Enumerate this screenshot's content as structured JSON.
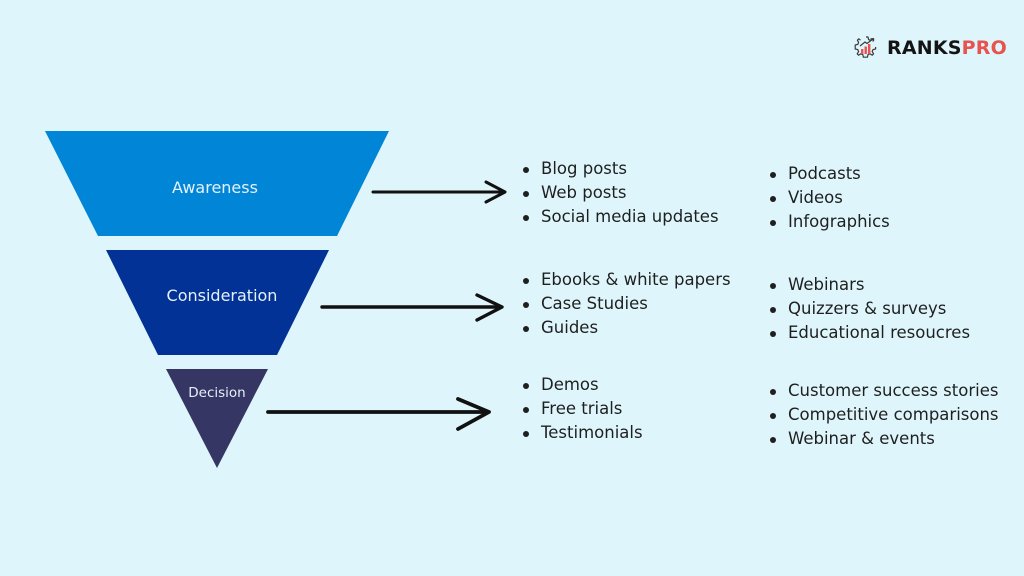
{
  "brand": {
    "name_part1": "RANKS",
    "name_part2": "PRO",
    "icon": "gear-chart-icon",
    "colors": {
      "dark": "#141414",
      "accent": "#e8524f"
    }
  },
  "background": "#def6fb",
  "funnel": {
    "stages": [
      {
        "label": "Awareness",
        "color": "#0185d6",
        "primary_items": [
          "Blog posts",
          "Web posts",
          "Social media updates"
        ],
        "secondary_items": [
          "Podcasts",
          "Videos",
          "Infographics"
        ]
      },
      {
        "label": "Consideration",
        "color": "#023295",
        "primary_items": [
          "Ebooks & white papers",
          "Case Studies",
          "Guides"
        ],
        "secondary_items": [
          "Webinars",
          "Quizzers & surveys",
          "Educational resoucres"
        ]
      },
      {
        "label": "Decision",
        "color": "#353663",
        "primary_items": [
          "Demos",
          "Free trials",
          "Testimonials"
        ],
        "secondary_items": [
          "Customer success stories",
          "Competitive comparisons",
          "Webinar & events"
        ]
      }
    ]
  }
}
